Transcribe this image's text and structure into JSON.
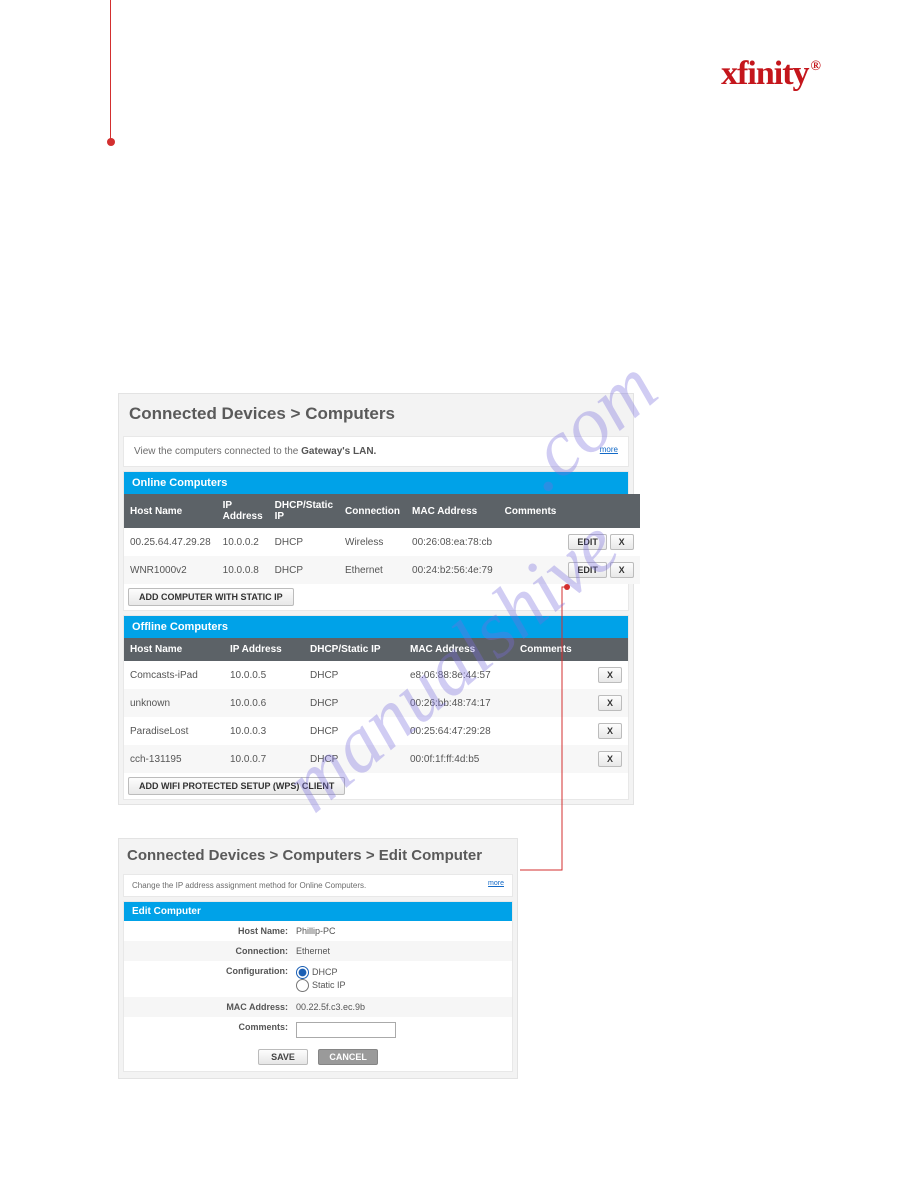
{
  "brand": "xfinity",
  "panel1": {
    "title": "Connected Devices > Computers",
    "info_text_pre": "View the computers connected to the ",
    "info_text_bold": "Gateway's LAN.",
    "more_link": "more",
    "online": {
      "header": "Online Computers",
      "cols": [
        "Host Name",
        "IP Address",
        "DHCP/Static IP",
        "Connection",
        "MAC Address",
        "Comments"
      ],
      "rows": [
        {
          "host": "00.25.64.47.29.28",
          "ip": "10.0.0.2",
          "dhcp": "DHCP",
          "conn": "Wireless",
          "mac": "00:26:08:ea:78:cb",
          "comments": ""
        },
        {
          "host": "WNR1000v2",
          "ip": "10.0.0.8",
          "dhcp": "DHCP",
          "conn": "Ethernet",
          "mac": "00:24:b2:56:4e:79",
          "comments": ""
        }
      ],
      "edit_label": "EDIT",
      "x_label": "X",
      "add_button": "ADD COMPUTER WITH STATIC IP"
    },
    "offline": {
      "header": "Offline Computers",
      "cols": [
        "Host Name",
        "IP Address",
        "DHCP/Static IP",
        "MAC Address",
        "Comments"
      ],
      "rows": [
        {
          "host": "Comcasts-iPad",
          "ip": "10.0.0.5",
          "dhcp": "DHCP",
          "mac": "e8:06:88:8e:44:57",
          "comments": ""
        },
        {
          "host": "unknown",
          "ip": "10.0.0.6",
          "dhcp": "DHCP",
          "mac": "00:26:bb:48:74:17",
          "comments": ""
        },
        {
          "host": "ParadiseLost",
          "ip": "10.0.0.3",
          "dhcp": "DHCP",
          "mac": "00:25:64:47:29:28",
          "comments": ""
        },
        {
          "host": "cch-131195",
          "ip": "10.0.0.7",
          "dhcp": "DHCP",
          "mac": "00:0f:1f:ff:4d:b5",
          "comments": ""
        }
      ],
      "x_label": "X",
      "add_button": "ADD WIFI PROTECTED SETUP (WPS) CLIENT"
    }
  },
  "panel2": {
    "title": "Connected Devices > Computers > Edit Computer",
    "info_text": "Change the IP address assignment method for Online Computers.",
    "more_link": "more",
    "form_header": "Edit Computer",
    "rows": {
      "host_label": "Host Name:",
      "host_value": "Phillip-PC",
      "conn_label": "Connection:",
      "conn_value": "Ethernet",
      "config_label": "Configuration:",
      "config_opt1": "DHCP",
      "config_opt2": "Static IP",
      "mac_label": "MAC Address:",
      "mac_value": "00.22.5f.c3.ec.9b",
      "comments_label": "Comments:"
    },
    "save_label": "SAVE",
    "cancel_label": "CANCEL"
  }
}
